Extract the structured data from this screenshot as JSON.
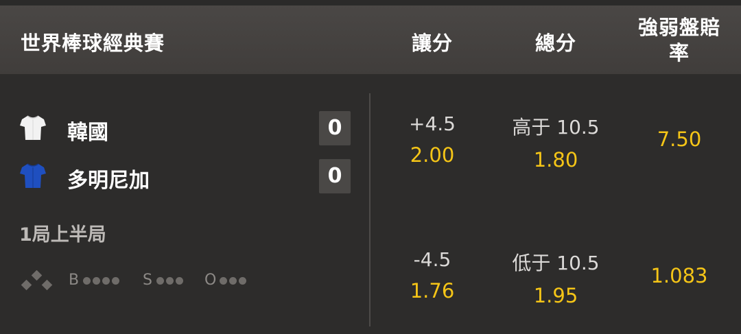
{
  "header": {
    "league": "世界棒球經典賽",
    "col_spread": "讓分",
    "col_total": "總分",
    "col_moneyline_1": "強弱盤賠",
    "col_moneyline_2": "率"
  },
  "match": {
    "teams": [
      {
        "name": "韓國",
        "score": "0",
        "jersey_color": "#f2f2f2",
        "jersey_icon": "white-jersey-icon"
      },
      {
        "name": "多明尼加",
        "score": "0",
        "jersey_color": "#1f4fbf",
        "jersey_icon": "blue-jersey-icon"
      }
    ],
    "inning": "1局上半局",
    "bso": {
      "b": "B",
      "s": "S",
      "o": "O"
    },
    "odds": {
      "spread": [
        {
          "line": "+4.5",
          "price": "2.00"
        },
        {
          "line": "-4.5",
          "price": "1.76"
        }
      ],
      "total": [
        {
          "line": "高于 10.5",
          "price": "1.80"
        },
        {
          "line": "低于 10.5",
          "price": "1.95"
        }
      ],
      "moneyline": [
        {
          "price": "7.50"
        },
        {
          "price": "1.083"
        }
      ]
    }
  },
  "colors": {
    "accent": "#f5c517",
    "header_bg": "#45423f",
    "body_bg": "#2d2c2b"
  }
}
